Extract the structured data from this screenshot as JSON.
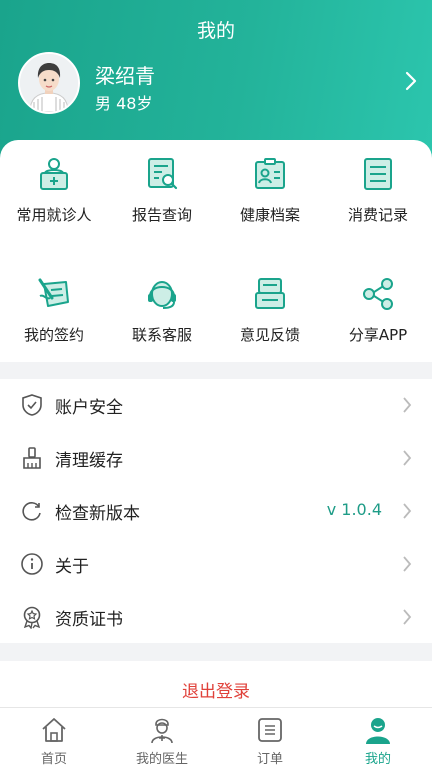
{
  "header": {
    "title": "我的"
  },
  "profile": {
    "name": "梁绍青",
    "info": "男  48岁"
  },
  "grid": [
    {
      "label": "常用就诊人",
      "icon": "patient-icon"
    },
    {
      "label": "报告查询",
      "icon": "report-search-icon"
    },
    {
      "label": "健康档案",
      "icon": "health-record-icon"
    },
    {
      "label": "消费记录",
      "icon": "consumption-record-icon"
    },
    {
      "label": "我的签约",
      "icon": "contract-icon"
    },
    {
      "label": "联系客服",
      "icon": "customer-service-icon"
    },
    {
      "label": "意见反馈",
      "icon": "feedback-icon"
    },
    {
      "label": "分享APP",
      "icon": "share-icon"
    }
  ],
  "menu": [
    {
      "label": "账户安全",
      "icon": "shield-icon",
      "value": ""
    },
    {
      "label": "清理缓存",
      "icon": "broom-icon",
      "value": ""
    },
    {
      "label": "检查新版本",
      "icon": "refresh-icon",
      "value": "v 1.0.4"
    },
    {
      "label": "关于",
      "icon": "info-icon",
      "value": ""
    },
    {
      "label": "资质证书",
      "icon": "certificate-icon",
      "value": ""
    }
  ],
  "logout_label": "退出登录",
  "tabs": [
    {
      "label": "首页",
      "icon": "home-icon"
    },
    {
      "label": "我的医生",
      "icon": "doctor-icon"
    },
    {
      "label": "订单",
      "icon": "order-icon"
    },
    {
      "label": "我的",
      "icon": "user-icon",
      "active": true
    }
  ],
  "colors": {
    "primary": "#1aa48c",
    "logout": "#e0413a"
  }
}
